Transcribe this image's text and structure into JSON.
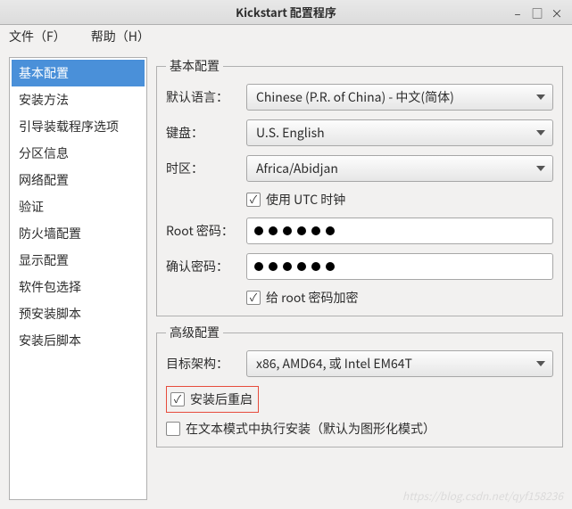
{
  "window": {
    "title": "Kickstart 配置程序"
  },
  "menu": {
    "file": "文件（F）",
    "help": "帮助（H）"
  },
  "sidebar": {
    "items": [
      "基本配置",
      "安装方法",
      "引导装载程序选项",
      "分区信息",
      "网络配置",
      "验证",
      "防火墙配置",
      "显示配置",
      "软件包选择",
      "预安装脚本",
      "安装后脚本"
    ]
  },
  "basic": {
    "legend": "基本配置",
    "labels": {
      "lang": "默认语言：",
      "keyboard": "键盘：",
      "tz": "时区：",
      "root": "Root 密码：",
      "confirm": "确认密码："
    },
    "lang": "Chinese (P.R. of China) - 中文(简体)",
    "keyboard": "U.S. English",
    "tz": "Africa/Abidjan",
    "utc": "使用  UTC 时钟",
    "encrypt": "给  root 密码加密"
  },
  "advanced": {
    "legend": "高级配置",
    "labels": {
      "arch": "目标架构："
    },
    "arch": "x86, AMD64, 或  Intel EM64T",
    "reboot": "安装后重启",
    "textmode": "在文本模式中执行安装（默认为图形化模式）"
  },
  "watermark": "https://blog.csdn.net/qyf158236"
}
